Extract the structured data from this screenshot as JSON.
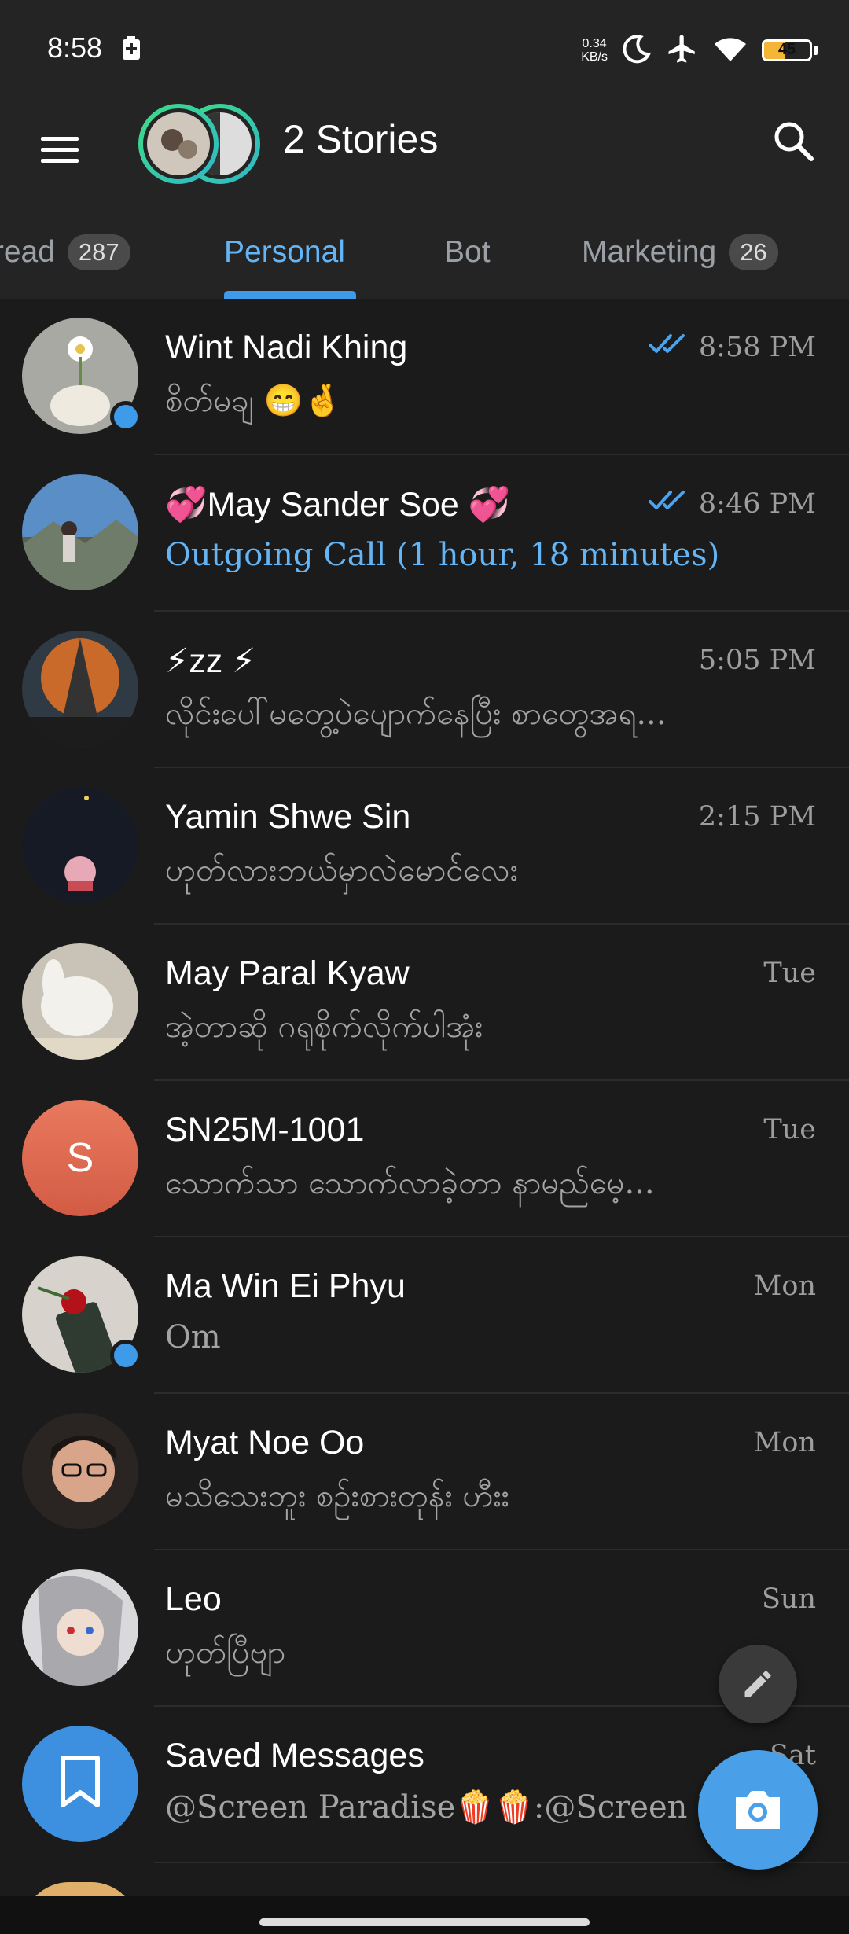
{
  "status_bar": {
    "time": "8:58",
    "net_speed_value": "0.34",
    "net_speed_unit": "KB/s",
    "battery": "45",
    "battery_level": 0.45,
    "icons": [
      "battery-saver-icon",
      "moon-icon",
      "airplane-icon",
      "wifi-icon",
      "battery-icon"
    ]
  },
  "header": {
    "title": "2 Stories",
    "menu_icon": "hamburger-menu-icon",
    "search_icon": "search-icon"
  },
  "tabs": [
    {
      "label": "Unread",
      "badge": "287"
    },
    {
      "label": "Personal",
      "badge": ""
    },
    {
      "label": "Bot",
      "badge": ""
    },
    {
      "label": "Marketing",
      "badge": "26"
    }
  ],
  "active_tab": "Personal",
  "chats": [
    {
      "name": "Wint Nadi Khing",
      "time": "8:58 PM",
      "message": "စိတ်မချ 😁🤞",
      "read": true,
      "online": true
    },
    {
      "name": "💞May Sander Soe 💞",
      "time": "8:46 PM",
      "message": "Outgoing Call (1 hour, 18 minutes)",
      "read": true,
      "online": false
    },
    {
      "name": "⚡zz ⚡",
      "time": "5:05 PM",
      "message": "လိုင်းပေါ်မတွေ့ပဲပျောက်နေပြီး စာတွေအရ...",
      "read": false,
      "online": false
    },
    {
      "name": "Yamin Shwe Sin",
      "time": "2:15 PM",
      "message": "ဟုတ်လားဘယ်မှာလဲမောင်လေး",
      "read": false,
      "online": false
    },
    {
      "name": "May Paral Kyaw",
      "time": "Tue",
      "message": "အဲ့တာဆို ဂရုစိုက်လိုက်ပါအုံး",
      "read": false,
      "online": false
    },
    {
      "name": "SN25M-1001",
      "time": "Tue",
      "message": "သောက်သာ သောက်လာခဲ့တာ နာမည်မေ့...",
      "read": false,
      "online": false,
      "initial": "S"
    },
    {
      "name": "Ma Win Ei Phyu",
      "time": "Mon",
      "message": "Om",
      "read": false,
      "online": true
    },
    {
      "name": "Myat Noe Oo",
      "time": "Mon",
      "message": "မသိသေးဘူး စဉ်းစားတုန်း ဟီးး",
      "read": false,
      "online": false
    },
    {
      "name": "Leo",
      "time": "Sun",
      "message": "ဟုတ်ပြီဗျာ",
      "read": false,
      "online": false
    },
    {
      "name": "Saved Messages",
      "time": "Sat",
      "message": "@Screen Paradise🍿🍿:@Screen Paradise",
      "read": false,
      "online": false
    }
  ],
  "colors": {
    "background": "#1b1b1b",
    "header": "#242424",
    "accent": "#3d9be9",
    "muted_text": "#a3a3a3"
  }
}
